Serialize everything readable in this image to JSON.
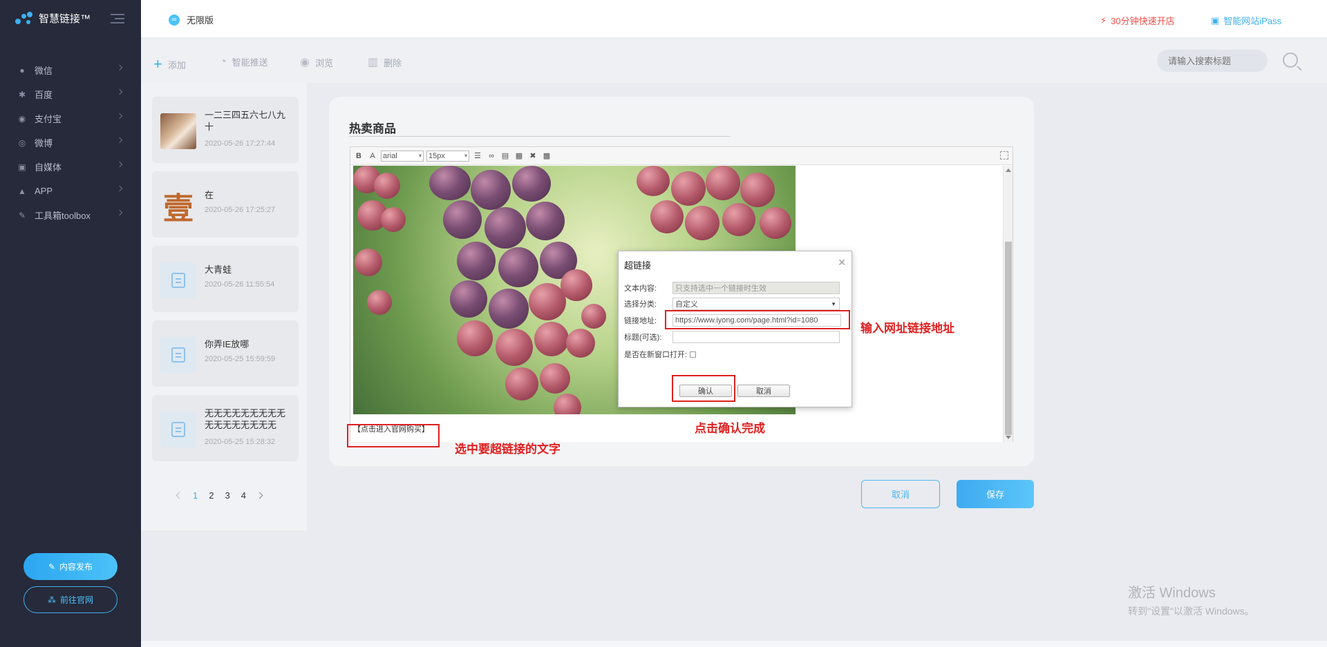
{
  "brand": {
    "name": "智慧链接™"
  },
  "sidebar": {
    "items": [
      {
        "label": "微信",
        "icon": "wechat-icon"
      },
      {
        "label": "百度",
        "icon": "paw-icon"
      },
      {
        "label": "支付宝",
        "icon": "alipay-icon"
      },
      {
        "label": "微博",
        "icon": "weibo-icon"
      },
      {
        "label": "自媒体",
        "icon": "media-icon"
      },
      {
        "label": "APP",
        "icon": "android-icon"
      },
      {
        "label": "工具箱toolbox",
        "icon": "wrench-icon"
      }
    ],
    "publish_label": "内容发布",
    "official_label": "前往官网"
  },
  "header": {
    "edition": "无限版",
    "quick_store": "30分钟快速开店",
    "ipass": "智能网站iPass"
  },
  "toolbar": {
    "add": "添加",
    "push": "智能推送",
    "view": "浏览",
    "delete": "删除",
    "search_placeholder": "请输入搜索标题"
  },
  "list": {
    "items": [
      {
        "title": "一二三四五六七八九十",
        "date": "2020-05-26 17:27:44",
        "thumb": "book"
      },
      {
        "title": "在",
        "date": "2020-05-26 17:25:27",
        "thumb": "char",
        "thumb_char": "壹"
      },
      {
        "title": "大青蛙",
        "date": "2020-05-26 11:55:54",
        "thumb": "doc"
      },
      {
        "title": "你弄IE放哪",
        "date": "2020-05-25 15:59:59",
        "thumb": "doc"
      },
      {
        "title": "无无无无无无无无无无无无无无无无无无...",
        "date": "2020-05-25 15:28:32",
        "thumb": "doc"
      }
    ],
    "pages": [
      "1",
      "2",
      "3",
      "4"
    ],
    "current_page": "1"
  },
  "editor": {
    "title": "热卖商品",
    "font": "arial",
    "size": "15px",
    "link_text": "【点击进入官网购买】"
  },
  "dialog": {
    "title": "超链接",
    "text_label": "文本内容:",
    "text_value": "只支持选中一个链接时生效",
    "category_label": "选择分类:",
    "category_value": "自定义",
    "url_label": "链接地址:",
    "url_value": "https://www.iyong.com/page.html?id=1080",
    "title_label": "标题(可选):",
    "title_value": "",
    "newwin_label": "是否在新窗口打开:",
    "ok": "确认",
    "cancel": "取消"
  },
  "annotations": {
    "url_hint": "输入网址链接地址",
    "confirm_hint": "点击确认完成",
    "select_hint": "选中要超链接的文字"
  },
  "actions": {
    "cancel": "取消",
    "save": "保存"
  },
  "watermark": {
    "line1": "激活 Windows",
    "line2": "转到\"设置\"以激活 Windows。"
  },
  "colors": {
    "accent": "#3fb0f0",
    "sidebar": "#262a3a",
    "annotation": "#e02020",
    "alert": "#f0504a"
  }
}
